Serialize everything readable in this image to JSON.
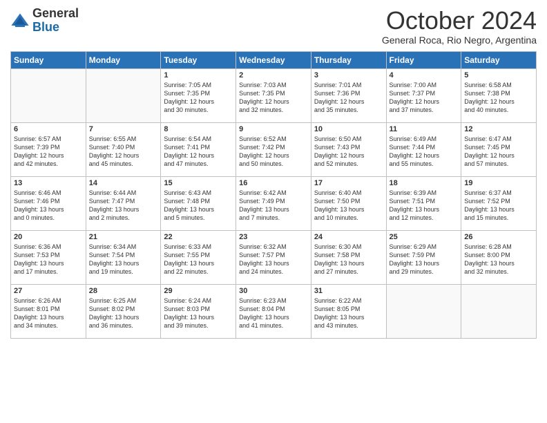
{
  "header": {
    "logo_general": "General",
    "logo_blue": "Blue",
    "month_title": "October 2024",
    "subtitle": "General Roca, Rio Negro, Argentina"
  },
  "weekdays": [
    "Sunday",
    "Monday",
    "Tuesday",
    "Wednesday",
    "Thursday",
    "Friday",
    "Saturday"
  ],
  "weeks": [
    [
      {
        "day": "",
        "info": ""
      },
      {
        "day": "",
        "info": ""
      },
      {
        "day": "1",
        "info": "Sunrise: 7:05 AM\nSunset: 7:35 PM\nDaylight: 12 hours\nand 30 minutes."
      },
      {
        "day": "2",
        "info": "Sunrise: 7:03 AM\nSunset: 7:35 PM\nDaylight: 12 hours\nand 32 minutes."
      },
      {
        "day": "3",
        "info": "Sunrise: 7:01 AM\nSunset: 7:36 PM\nDaylight: 12 hours\nand 35 minutes."
      },
      {
        "day": "4",
        "info": "Sunrise: 7:00 AM\nSunset: 7:37 PM\nDaylight: 12 hours\nand 37 minutes."
      },
      {
        "day": "5",
        "info": "Sunrise: 6:58 AM\nSunset: 7:38 PM\nDaylight: 12 hours\nand 40 minutes."
      }
    ],
    [
      {
        "day": "6",
        "info": "Sunrise: 6:57 AM\nSunset: 7:39 PM\nDaylight: 12 hours\nand 42 minutes."
      },
      {
        "day": "7",
        "info": "Sunrise: 6:55 AM\nSunset: 7:40 PM\nDaylight: 12 hours\nand 45 minutes."
      },
      {
        "day": "8",
        "info": "Sunrise: 6:54 AM\nSunset: 7:41 PM\nDaylight: 12 hours\nand 47 minutes."
      },
      {
        "day": "9",
        "info": "Sunrise: 6:52 AM\nSunset: 7:42 PM\nDaylight: 12 hours\nand 50 minutes."
      },
      {
        "day": "10",
        "info": "Sunrise: 6:50 AM\nSunset: 7:43 PM\nDaylight: 12 hours\nand 52 minutes."
      },
      {
        "day": "11",
        "info": "Sunrise: 6:49 AM\nSunset: 7:44 PM\nDaylight: 12 hours\nand 55 minutes."
      },
      {
        "day": "12",
        "info": "Sunrise: 6:47 AM\nSunset: 7:45 PM\nDaylight: 12 hours\nand 57 minutes."
      }
    ],
    [
      {
        "day": "13",
        "info": "Sunrise: 6:46 AM\nSunset: 7:46 PM\nDaylight: 13 hours\nand 0 minutes."
      },
      {
        "day": "14",
        "info": "Sunrise: 6:44 AM\nSunset: 7:47 PM\nDaylight: 13 hours\nand 2 minutes."
      },
      {
        "day": "15",
        "info": "Sunrise: 6:43 AM\nSunset: 7:48 PM\nDaylight: 13 hours\nand 5 minutes."
      },
      {
        "day": "16",
        "info": "Sunrise: 6:42 AM\nSunset: 7:49 PM\nDaylight: 13 hours\nand 7 minutes."
      },
      {
        "day": "17",
        "info": "Sunrise: 6:40 AM\nSunset: 7:50 PM\nDaylight: 13 hours\nand 10 minutes."
      },
      {
        "day": "18",
        "info": "Sunrise: 6:39 AM\nSunset: 7:51 PM\nDaylight: 13 hours\nand 12 minutes."
      },
      {
        "day": "19",
        "info": "Sunrise: 6:37 AM\nSunset: 7:52 PM\nDaylight: 13 hours\nand 15 minutes."
      }
    ],
    [
      {
        "day": "20",
        "info": "Sunrise: 6:36 AM\nSunset: 7:53 PM\nDaylight: 13 hours\nand 17 minutes."
      },
      {
        "day": "21",
        "info": "Sunrise: 6:34 AM\nSunset: 7:54 PM\nDaylight: 13 hours\nand 19 minutes."
      },
      {
        "day": "22",
        "info": "Sunrise: 6:33 AM\nSunset: 7:55 PM\nDaylight: 13 hours\nand 22 minutes."
      },
      {
        "day": "23",
        "info": "Sunrise: 6:32 AM\nSunset: 7:57 PM\nDaylight: 13 hours\nand 24 minutes."
      },
      {
        "day": "24",
        "info": "Sunrise: 6:30 AM\nSunset: 7:58 PM\nDaylight: 13 hours\nand 27 minutes."
      },
      {
        "day": "25",
        "info": "Sunrise: 6:29 AM\nSunset: 7:59 PM\nDaylight: 13 hours\nand 29 minutes."
      },
      {
        "day": "26",
        "info": "Sunrise: 6:28 AM\nSunset: 8:00 PM\nDaylight: 13 hours\nand 32 minutes."
      }
    ],
    [
      {
        "day": "27",
        "info": "Sunrise: 6:26 AM\nSunset: 8:01 PM\nDaylight: 13 hours\nand 34 minutes."
      },
      {
        "day": "28",
        "info": "Sunrise: 6:25 AM\nSunset: 8:02 PM\nDaylight: 13 hours\nand 36 minutes."
      },
      {
        "day": "29",
        "info": "Sunrise: 6:24 AM\nSunset: 8:03 PM\nDaylight: 13 hours\nand 39 minutes."
      },
      {
        "day": "30",
        "info": "Sunrise: 6:23 AM\nSunset: 8:04 PM\nDaylight: 13 hours\nand 41 minutes."
      },
      {
        "day": "31",
        "info": "Sunrise: 6:22 AM\nSunset: 8:05 PM\nDaylight: 13 hours\nand 43 minutes."
      },
      {
        "day": "",
        "info": ""
      },
      {
        "day": "",
        "info": ""
      }
    ]
  ]
}
